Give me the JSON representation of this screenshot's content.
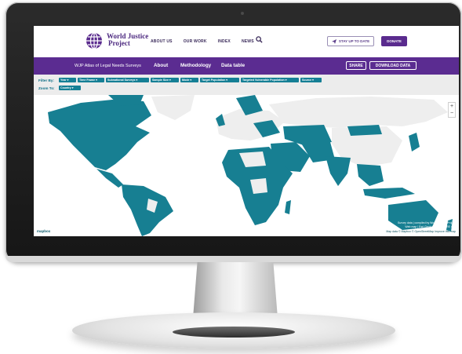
{
  "site": {
    "logo_line1": "World Justice",
    "logo_line2": "Project",
    "nav": [
      "ABOUT US",
      "OUR WORK",
      "INDEX",
      "NEWS"
    ],
    "stay_up_to_date": "STAY UP TO DATE",
    "donate": "DONATE"
  },
  "atlas_bar": {
    "title": "WJP Atlas of Legal Needs Surveys",
    "tabs": [
      "About",
      "Methodology",
      "Data table"
    ],
    "share": "SHARE",
    "download": "DOWNLOAD DATA"
  },
  "filters": {
    "filter_by_label": "Filter By:",
    "zoom_to_label": "Zoom To:",
    "chips": [
      "Year",
      "Time Frame",
      "Subnational Surveys",
      "Sample Size",
      "Mode",
      "Target Population",
      "Targeted Vulnerable Population",
      "Source"
    ],
    "zoom_chip": "Country"
  },
  "map": {
    "zoom_in": "+",
    "zoom_out": "−",
    "mapbox_logo": "mapbox",
    "attribution_line1": "Survey data | compiled by World Justice Project",
    "attribution_line2": "Web map | Esri Geolocating & CDRE GIS",
    "attribution_line3": "Map data © Mapbox © OpenStreetMap Improve this map",
    "colors": {
      "surveyed": "#177f92",
      "not_surveyed": "#eeeeee",
      "ocean": "#ffffff"
    }
  },
  "colors": {
    "brand_purple": "#5b2c91",
    "teal": "#157f95"
  }
}
